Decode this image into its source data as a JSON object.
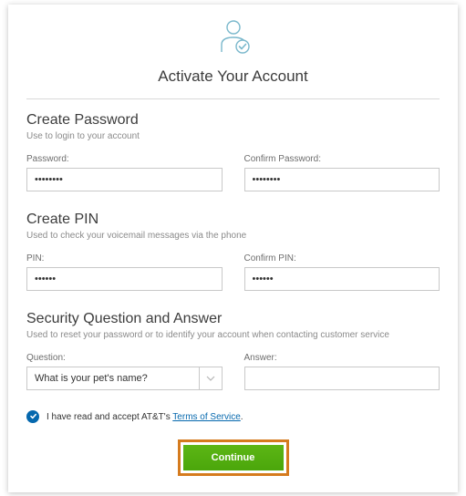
{
  "header": {
    "title": "Activate Your Account"
  },
  "sections": {
    "password": {
      "title": "Create Password",
      "subtitle": "Use to login to your account",
      "field1_label": "Password:",
      "field1_value": "••••••••",
      "field2_label": "Confirm Password:",
      "field2_value": "••••••••"
    },
    "pin": {
      "title": "Create PIN",
      "subtitle": "Used to check your voicemail messages via the phone",
      "field1_label": "PIN:",
      "field1_value": "••••••",
      "field2_label": "Confirm PIN:",
      "field2_value": "••••••"
    },
    "security": {
      "title": "Security Question and Answer",
      "subtitle": "Used to reset your password or to identify your account when contacting customer service",
      "question_label": "Question:",
      "question_value": "What is your pet's name?",
      "answer_label": "Answer:",
      "answer_value": ""
    }
  },
  "tos": {
    "checked": true,
    "text_prefix": "I have read and accept AT&T's ",
    "link_text": "Terms of Service",
    "text_suffix": "."
  },
  "actions": {
    "continue_label": "Continue"
  },
  "icons": {
    "header": "user-check-icon",
    "caret": "chevron-down-icon",
    "check": "checkmark-icon"
  }
}
